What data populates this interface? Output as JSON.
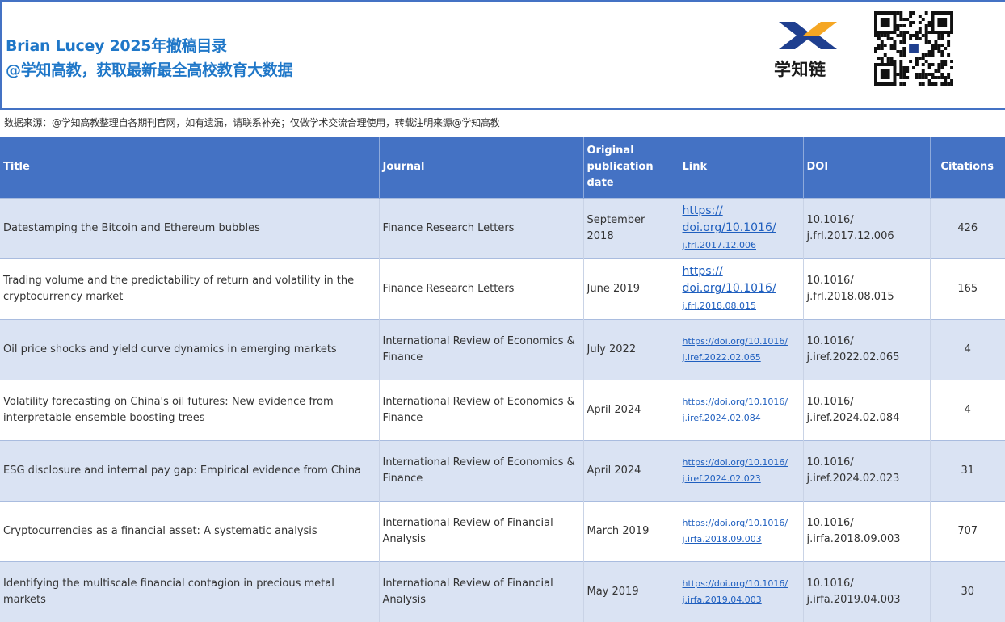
{
  "header": {
    "title_line1": "Brian Lucey 2025年撤稿目录",
    "title_line2": "@学知高教，获取最新最全高校教育大数据",
    "logo_text": "学知链",
    "qr_label": "qr-code"
  },
  "source_note": "数据来源：@学知高教整理自各期刊官网，如有遗漏，请联系补充；仅做学术交流合理使用，转载注明来源@学知高教",
  "table": {
    "columns": [
      "Title",
      "Journal",
      "Original publication date",
      "Link",
      "DOI",
      "Citations"
    ],
    "rows": [
      {
        "title": "Datestamping the Bitcoin and Ethereum bubbles",
        "journal": "Finance Research Letters",
        "date": "September 2018",
        "link_a": "https://",
        "link_b": "doi.org/10.1016/",
        "link_c": "j.frl.2017.12.006",
        "doi_a": "10.1016/",
        "doi_b": "j.frl.2017.12.006",
        "citations": "426"
      },
      {
        "title": "Trading volume and the predictability of return and volatility in the cryptocurrency market",
        "journal": "Finance Research Letters",
        "date": "June 2019",
        "link_a": "https://",
        "link_b": "doi.org/10.1016/",
        "link_c": "j.frl.2018.08.015",
        "doi_a": "10.1016/",
        "doi_b": "j.frl.2018.08.015",
        "citations": "165"
      },
      {
        "title": "Oil price shocks and yield curve dynamics in emerging markets",
        "journal": "International Review of Economics & Finance",
        "date": "July 2022",
        "link_a": "https://doi.org/10.1016/",
        "link_b": "j.iref.2022.02.065",
        "doi_a": "10.1016/",
        "doi_b": "j.iref.2022.02.065",
        "citations": "4"
      },
      {
        "title": "Volatility forecasting on China's oil futures: New evidence from interpretable ensemble boosting trees",
        "journal": "International Review of Economics & Finance",
        "date": "April 2024",
        "link_a": "https://doi.org/10.1016/",
        "link_b": "j.iref.2024.02.084",
        "doi_a": "10.1016/",
        "doi_b": "j.iref.2024.02.084",
        "citations": "4"
      },
      {
        "title": "ESG disclosure and internal pay gap: Empirical evidence from China",
        "journal": "International Review of Economics & Finance",
        "date": "April 2024",
        "link_a": "https://doi.org/10.1016/",
        "link_b": "j.iref.2024.02.023",
        "doi_a": "10.1016/",
        "doi_b": "j.iref.2024.02.023",
        "citations": "31"
      },
      {
        "title": "Cryptocurrencies as a financial asset: A systematic analysis",
        "journal": "International Review of Financial Analysis",
        "date": "March 2019",
        "link_a": "https://doi.org/10.1016/",
        "link_b": "j.irfa.2018.09.003",
        "doi_a": "10.1016/",
        "doi_b": "j.irfa.2018.09.003",
        "citations": "707"
      },
      {
        "title": "Identifying the multiscale financial contagion in precious metal markets",
        "journal": "International Review of Financial Analysis",
        "date": "May 2019",
        "link_a": "https://doi.org/10.1016/",
        "link_b": "j.irfa.2019.04.003",
        "doi_a": "10.1016/",
        "doi_b": "j.irfa.2019.04.003",
        "citations": "30"
      }
    ]
  },
  "colors": {
    "header_bg": "#4472c4",
    "row_shade": "#dae3f3",
    "title_blue": "#1f77c8",
    "link": "#1f5fbf",
    "logo_blue": "#1f3f8f",
    "logo_orange": "#f5a623"
  }
}
